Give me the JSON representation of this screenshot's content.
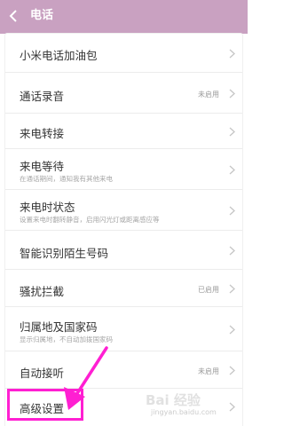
{
  "header": {
    "title": "电话",
    "background": "#c9a1c1"
  },
  "icons": {
    "back": "chevron-left-icon",
    "row_arrow": "chevron-right-icon"
  },
  "rows": [
    {
      "label": "小米电话加油包",
      "sub": "",
      "status": ""
    },
    {
      "label": "通话录音",
      "sub": "",
      "status": "未启用"
    },
    {
      "label": "来电转接",
      "sub": "",
      "status": ""
    },
    {
      "label": "来电等待",
      "sub": "在通话期间，通知我有其他来电",
      "status": ""
    },
    {
      "label": "来电时状态",
      "sub": "设置来电时翻转静音，启用闪光灯或距离感应等",
      "status": ""
    },
    {
      "label": "智能识别陌生号码",
      "sub": "",
      "status": ""
    },
    {
      "label": "骚扰拦截",
      "sub": "",
      "status": "已启用"
    },
    {
      "label": "归属地及国家码",
      "sub": "显示归属地，不自动加拨国家码",
      "status": ""
    },
    {
      "label": "自动接听",
      "sub": "",
      "status": "未启用"
    },
    {
      "label": "高级设置",
      "sub": "",
      "status": ""
    }
  ],
  "annotation": {
    "highlight_color": "#ff1fd2",
    "highlighted_row": "高级设置"
  },
  "watermark": {
    "main": "Bai 经验",
    "sub": "jingyan.baidu.com"
  }
}
